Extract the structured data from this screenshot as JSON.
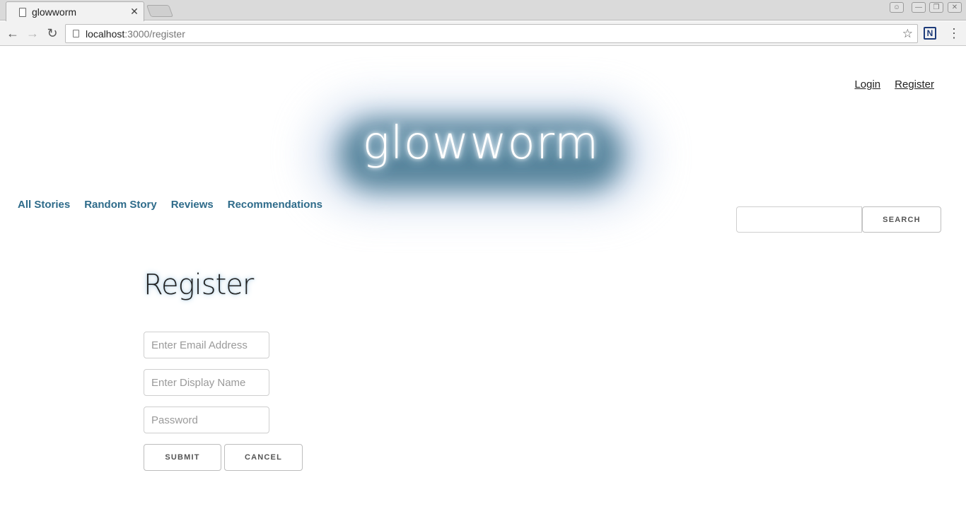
{
  "browser": {
    "tab_title": "glowworm",
    "url_host": "localhost",
    "url_path": ":3000/register",
    "icons": {
      "back": "back-arrow-icon",
      "forward": "forward-arrow-icon",
      "reload": "reload-icon",
      "star": "bookmark-star-icon",
      "extension": "extension-icon",
      "menu": "kebab-menu-icon"
    }
  },
  "header": {
    "logo_text": "glowworm",
    "links": {
      "login": "Login",
      "register": "Register"
    }
  },
  "nav": {
    "items": [
      "All Stories",
      "Random Story",
      "Reviews",
      "Recommendations"
    ]
  },
  "search": {
    "placeholder": "",
    "button_label": "SEARCH"
  },
  "form": {
    "title": "Register",
    "email_placeholder": "Enter Email Address",
    "display_name_placeholder": "Enter Display Name",
    "password_placeholder": "Password",
    "submit_label": "SUBMIT",
    "cancel_label": "CANCEL"
  },
  "colors": {
    "nav_link": "#2e6b8a",
    "logo_glow": "#4e7e96"
  }
}
